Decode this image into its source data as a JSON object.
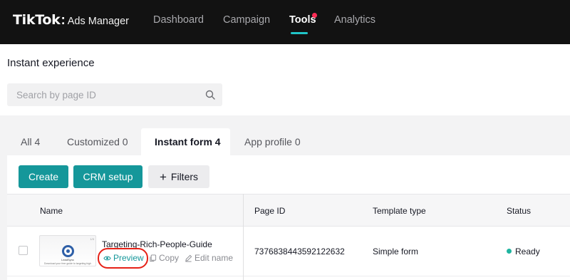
{
  "app": {
    "logo": "TikTok",
    "logo_sep": ":",
    "product": "Ads Manager"
  },
  "nav": {
    "items": [
      {
        "label": "Dashboard"
      },
      {
        "label": "Campaign"
      },
      {
        "label": "Tools"
      },
      {
        "label": "Analytics"
      }
    ],
    "active": "Tools"
  },
  "page": {
    "title": "Instant experience"
  },
  "search": {
    "placeholder": "Search by page ID",
    "value": ""
  },
  "tabs": [
    {
      "label": "All 4"
    },
    {
      "label": "Customized 0"
    },
    {
      "label": "Instant form 4"
    },
    {
      "label": "App profile 0"
    }
  ],
  "actions": {
    "create": "Create",
    "crm_setup": "CRM setup",
    "filters": "Filters"
  },
  "table": {
    "headers": [
      "Name",
      "Page ID",
      "Template type",
      "Status"
    ],
    "rows": [
      {
        "name": "Targeting-Rich-People-Guide",
        "thumb_brand": "LeadSync",
        "thumb_caption": "Download your free guide to targeting high",
        "thumb_badge": "1/3",
        "preview": "Preview",
        "copy": "Copy",
        "edit_name": "Edit name",
        "page_id": "7376838443592122632",
        "template_type": "Simple form",
        "status": "Ready"
      }
    ]
  },
  "colors": {
    "accent": "#15979a",
    "status_ready": "#20b4a0",
    "highlight_ring": "#e62117",
    "notification_dot": "#fe2c55"
  }
}
